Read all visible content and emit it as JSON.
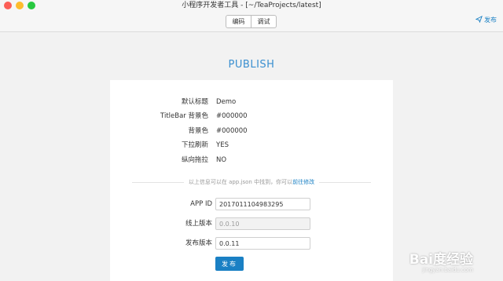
{
  "window": {
    "title": "小程序开发者工具 - [~/TeaProjects/latest]"
  },
  "toolbar": {
    "tabs": [
      {
        "label": "编码"
      },
      {
        "label": "调试"
      }
    ],
    "publish_label": "发布",
    "publish_icon": "send-icon"
  },
  "main": {
    "heading": "PUBLISH",
    "info": [
      {
        "label": "默认标题",
        "value": "Demo"
      },
      {
        "label": "TitleBar 背景色",
        "value": "#000000"
      },
      {
        "label": "背景色",
        "value": "#000000"
      },
      {
        "label": "下拉刷新",
        "value": "YES"
      },
      {
        "label": "纵向拖拉",
        "value": "NO"
      }
    ],
    "note_text": "以上信息可以在 app.json 中找到，你可以",
    "note_link": "前往修改",
    "form": {
      "app_id_label": "APP ID",
      "app_id_value": "2017011104983295",
      "online_version_label": "线上版本",
      "online_version_placeholder": "0.0.10",
      "release_version_label": "发布版本",
      "release_version_value": "0.0.11",
      "submit_label": "发布"
    }
  },
  "watermark": {
    "main": "Bai度经验",
    "sub": "jingyan.baidu.com"
  },
  "colors": {
    "accent": "#1a80c4",
    "heading": "#3a8fd0",
    "background": "#f2f2f2"
  }
}
